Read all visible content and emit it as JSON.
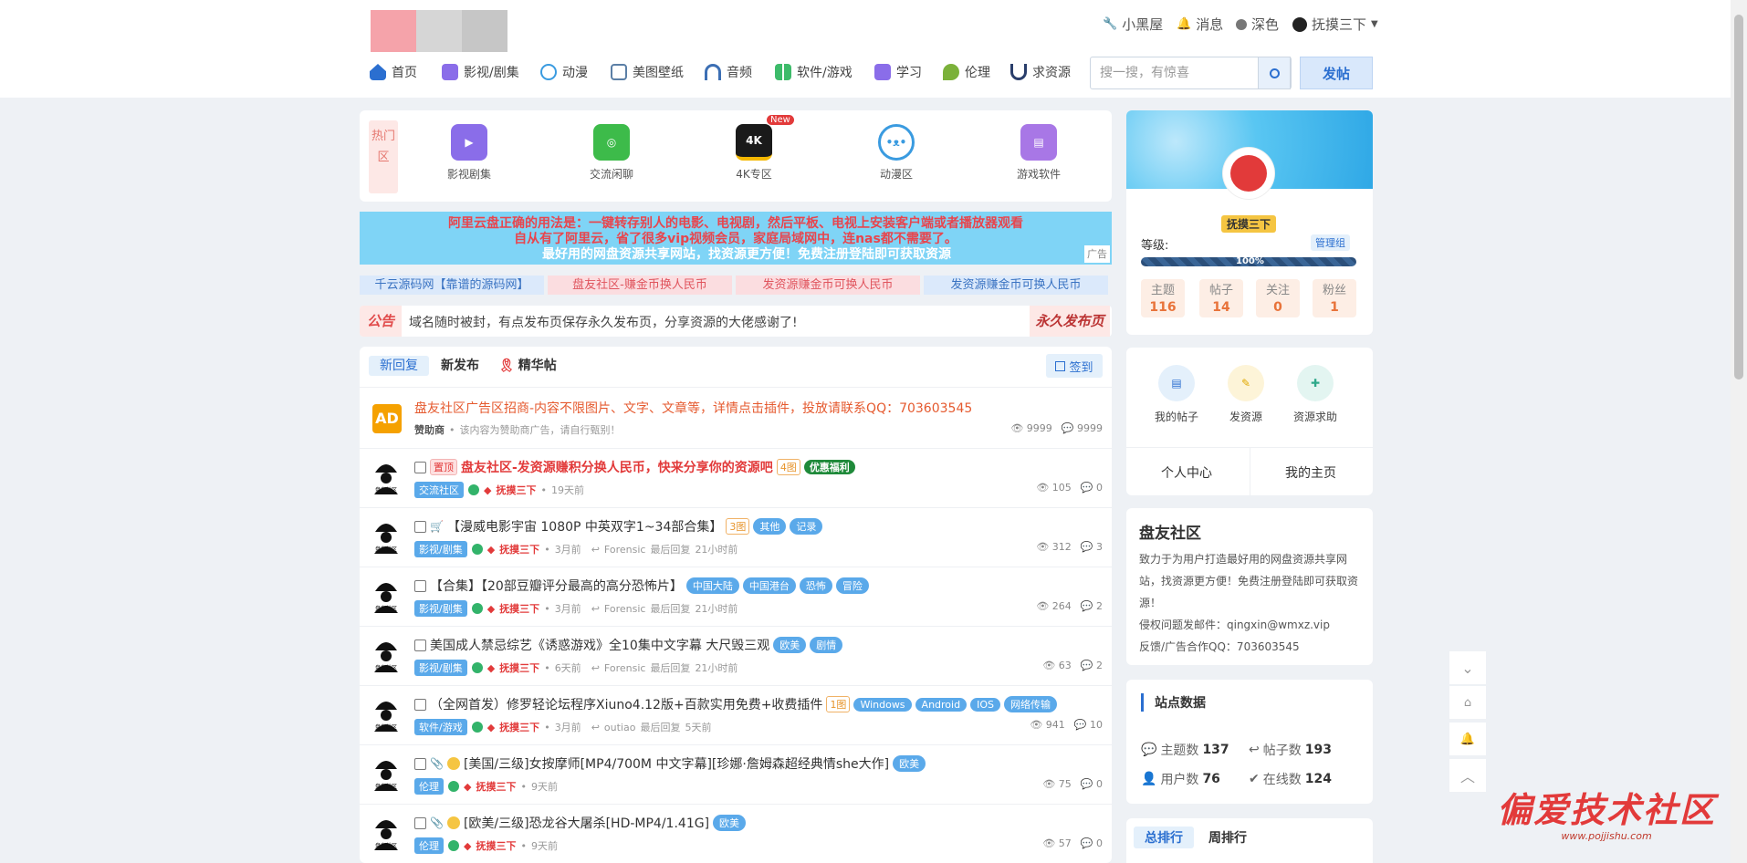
{
  "topbar": {
    "links": [
      {
        "label": "小黑屋",
        "icon": "wrench-icon"
      },
      {
        "label": "消息",
        "icon": "bell-icon"
      },
      {
        "label": "深色",
        "icon": "circle-icon"
      },
      {
        "label": "抚摸三下",
        "icon": "user-avatar-icon"
      }
    ]
  },
  "nav": {
    "items": [
      {
        "label": "首页",
        "icon": "home-icon",
        "color": "#2b6fd0"
      },
      {
        "label": "影视/剧集",
        "icon": "video-icon",
        "color": "#8a6de9"
      },
      {
        "label": "动漫",
        "icon": "bear-icon",
        "color": "#3a9be0"
      },
      {
        "label": "美图壁纸",
        "icon": "image-icon",
        "color": "#5b7fa6"
      },
      {
        "label": "音频",
        "icon": "headphones-icon",
        "color": "#3c6fb4"
      },
      {
        "label": "软件/游戏",
        "icon": "grid-icon",
        "color": "#3dbb6a"
      },
      {
        "label": "学习",
        "icon": "book-icon",
        "color": "#8a6de9"
      },
      {
        "label": "伦理",
        "icon": "leaf-icon",
        "color": "#7bb13a"
      },
      {
        "label": "求资源",
        "icon": "magnet-icon",
        "color": "#2a3e6b"
      }
    ],
    "search_placeholder": "搜一搜，有惊喜",
    "post_label": "发帖"
  },
  "hot": {
    "tag": "热门区",
    "items": [
      {
        "label": "影视剧集",
        "icon": "video-camera-icon",
        "color": "#8a6de9",
        "glyph": "▶"
      },
      {
        "label": "交流闲聊",
        "icon": "wechat-icon",
        "color": "#3dbb4a",
        "glyph": "◎"
      },
      {
        "label": "4K专区",
        "icon": "4k-icon",
        "color": "#f5b800",
        "glyph": "4K",
        "badge": "New"
      },
      {
        "label": "动漫区",
        "icon": "bear-icon",
        "color": "#3a9be0",
        "glyph": "ʕ•ᴥ•ʔ"
      },
      {
        "label": "游戏软件",
        "icon": "book-icon",
        "color": "#a877e6",
        "glyph": "▤"
      }
    ]
  },
  "ad_banner": {
    "line1": "阿里云盘正确的用法是：一键转存别人的电影、电视剧，然后平板、电视上安装客户端或者播放器观看",
    "line2": "自从有了阿里云，省了很多vip视频会员，家庭局域网中，连nas都不需要了。",
    "line3": "最好用的网盘资源共享网站，找资源更方便！免费注册登陆即可获取资源",
    "label": "广告"
  },
  "chips": [
    {
      "label": "千云源码网【靠谱的源码网】",
      "bg": "#dbe9fb",
      "fg": "#3a73c2"
    },
    {
      "label": "盘友社区-赚金币换人民币",
      "bg": "#fbdde0",
      "fg": "#e0555e"
    },
    {
      "label": "发资源赚金币可换人民币",
      "bg": "#fbdde0",
      "fg": "#e0555e"
    },
    {
      "label": "发资源赚金币可换人民币",
      "bg": "#dbe9fb",
      "fg": "#3a73c2"
    }
  ],
  "notice": {
    "title": "公告",
    "text": "域名随时被封，有点发布页保存永久发布页，分享资源的大佬感谢了!",
    "link": "永久发布页"
  },
  "tabs": {
    "items": [
      "新回复",
      "新发布",
      "精华帖"
    ],
    "signin": "签到"
  },
  "ad_row": {
    "badge": "AD",
    "title": "盘友社区广告区招商-内容不限图片、文字、文章等，详情点击插件，投放请联系QQ：703603545",
    "sponsor": "赞助商",
    "note": "该内容为赞助商广告，请自行甄别！",
    "views": "9999",
    "replies": "9999"
  },
  "threads": [
    {
      "pin": "置顶",
      "title": "盘友社区-发资源赚积分换人民币，快来分享你的资源吧",
      "img": "4图",
      "tags": [],
      "special": "优惠福利",
      "cat": "交流社区",
      "user": "抚摸三下",
      "time": "19天前",
      "last_user": "",
      "last_label": "",
      "last_time": "",
      "views": "105",
      "replies": "0",
      "red": true,
      "lead": ""
    },
    {
      "pin": "",
      "title": "【漫威电影宇宙 1080P 中英双字1~34部合集】",
      "img": "3图",
      "tags": [
        "其他",
        "记录"
      ],
      "special": "",
      "cat": "影视/剧集",
      "user": "抚摸三下",
      "time": "3月前",
      "last_user": "Forensic",
      "last_label": "最后回复",
      "last_time": "21小时前",
      "views": "312",
      "replies": "3",
      "red": false,
      "lead": "cart"
    },
    {
      "pin": "",
      "title": "【合集】【20部豆瓣评分最高的高分恐怖片】",
      "img": "",
      "tags": [
        "中国大陆",
        "中国港台",
        "恐怖",
        "冒险"
      ],
      "special": "",
      "cat": "影视/剧集",
      "user": "抚摸三下",
      "time": "3月前",
      "last_user": "Forensic",
      "last_label": "最后回复",
      "last_time": "21小时前",
      "views": "264",
      "replies": "2",
      "red": false,
      "lead": ""
    },
    {
      "pin": "",
      "title": "美国成人禁忌综艺《诱惑游戏》全10集中文字幕 大尺毁三观",
      "img": "",
      "tags": [
        "欧美",
        "剧情"
      ],
      "special": "",
      "cat": "影视/剧集",
      "user": "抚摸三下",
      "time": "6天前",
      "last_user": "Forensic",
      "last_label": "最后回复",
      "last_time": "21小时前",
      "views": "63",
      "replies": "2",
      "red": false,
      "lead": ""
    },
    {
      "pin": "",
      "title": "（全网首发）修罗轻论坛程序Xiuno4.12版+百款实用免费+收费插件",
      "img": "1图",
      "tags": [
        "Windows",
        "Android",
        "IOS",
        "网络传输"
      ],
      "special": "",
      "cat": "软件/游戏",
      "user": "抚摸三下",
      "time": "3月前",
      "last_user": "outiao",
      "last_label": "最后回复",
      "last_time": "5天前",
      "views": "941",
      "replies": "10",
      "red": false,
      "lead": ""
    },
    {
      "pin": "",
      "title": "[美国/三级]女按摩师[MP4/700M 中文字幕][珍娜·詹姆森超经典情she大作]",
      "img": "",
      "tags": [
        "欧美"
      ],
      "special": "",
      "cat": "伦理",
      "user": "抚摸三下",
      "time": "9天前",
      "last_user": "",
      "last_label": "",
      "last_time": "",
      "views": "75",
      "replies": "0",
      "red": false,
      "lead": "clip-coin"
    },
    {
      "pin": "",
      "title": "[欧美/三级]恐龙谷大屠杀[HD-MP4/1.41G]",
      "img": "",
      "tags": [
        "欧美"
      ],
      "special": "",
      "cat": "伦理",
      "user": "抚摸三下",
      "time": "9天前",
      "last_user": "",
      "last_label": "",
      "last_time": "",
      "views": "57",
      "replies": "0",
      "red": false,
      "lead": "clip-coin"
    }
  ],
  "profile": {
    "name": "抚摸三下",
    "level_label": "等级:",
    "group": "管理组",
    "progress_text": "100%",
    "progress": 1.0,
    "stats": [
      {
        "label": "主题",
        "value": "116"
      },
      {
        "label": "帖子",
        "value": "14"
      },
      {
        "label": "关注",
        "value": "0"
      },
      {
        "label": "粉丝",
        "value": "1"
      }
    ]
  },
  "quick": {
    "items": [
      {
        "label": "我的帖子",
        "icon": "document-icon",
        "color": "#e4f0fb",
        "fg": "#2b6fd0"
      },
      {
        "label": "发资源",
        "icon": "edit-icon",
        "color": "#fdf4d8",
        "fg": "#e0a800"
      },
      {
        "label": "资源求助",
        "icon": "help-icon",
        "color": "#e3f5f1",
        "fg": "#2ea88a"
      }
    ],
    "center": "个人中心",
    "home": "我的主页"
  },
  "about": {
    "title": "盘友社区",
    "desc": "致力于为用户打造最好用的网盘资源共享网站，找资源更方便！免费注册登陆即可获取资源！",
    "contact_mail": "侵权问题发邮件：qingxin@wmxz.vip",
    "contact_qq": "反馈/广告合作QQ：703603545"
  },
  "site_stats": {
    "title": "站点数据",
    "items": [
      {
        "label": "主题数",
        "value": "137",
        "icon": "chat-icon"
      },
      {
        "label": "帖子数",
        "value": "193",
        "icon": "reply-icon"
      },
      {
        "label": "用户数",
        "value": "76",
        "icon": "user-icon"
      },
      {
        "label": "在线数",
        "value": "124",
        "icon": "check-icon"
      }
    ]
  },
  "ranking": {
    "tabs": [
      "总排行",
      "周排行"
    ]
  },
  "watermark": {
    "text": "偏爱技术社区",
    "url": "www.pojjishu.com"
  }
}
